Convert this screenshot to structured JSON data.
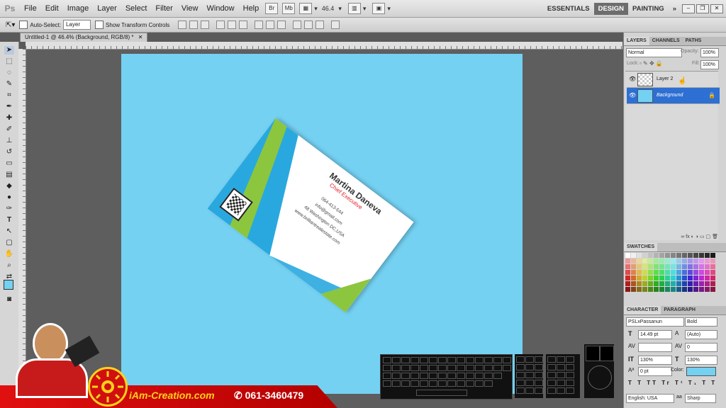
{
  "app": {
    "logo": "Ps"
  },
  "menu": [
    "File",
    "Edit",
    "Image",
    "Layer",
    "Select",
    "Filter",
    "View",
    "Window",
    "Help"
  ],
  "menubar": {
    "zoom": "46.4",
    "workspaces": [
      "ESSENTIALS",
      "DESIGN",
      "PAINTING"
    ],
    "active_workspace": "DESIGN",
    "more": "»"
  },
  "options_bar": {
    "auto_select_label": "Auto-Select:",
    "auto_select_value": "Layer",
    "show_transform_label": "Show Transform Controls"
  },
  "document": {
    "tab_title": "Untitled-1 @ 46.4% (Background, RGB/8) *"
  },
  "card": {
    "name": "Martina Daneva",
    "title": "Chief Executive",
    "phone": "064-413-544",
    "email": "info@gmail.com",
    "address": "48 Washington DC,USA",
    "website": "www.brilliantrealestate.com"
  },
  "layers_panel": {
    "tabs": [
      "LAYERS",
      "CHANNELS",
      "PATHS"
    ],
    "blend_mode": "Normal",
    "opacity_label": "Opacity:",
    "opacity_value": "100%",
    "lock_label": "Lock:",
    "fill_label": "Fill:",
    "fill_value": "100%",
    "layers": [
      {
        "name": "Layer 2",
        "selected": false
      },
      {
        "name": "Background",
        "selected": true
      }
    ]
  },
  "swatches_panel": {
    "title": "SWATCHES"
  },
  "character_panel": {
    "tabs": [
      "CHARACTER",
      "PARAGRAPH"
    ],
    "font_family": "PSLxPassanun",
    "font_style": "Bold",
    "font_size": "14.49 pt",
    "leading": "(Auto)",
    "tracking": "0",
    "vertical_scale": "130%",
    "horizontal_scale": "130%",
    "baseline_shift": "0 pt",
    "color_label": "Color:",
    "language": "English: USA",
    "antialias_icon": "aa",
    "antialias": "Sharp"
  },
  "branding": {
    "site": "iAm-Creation.com",
    "phone": "061-3460479"
  },
  "colors": {
    "canvas": "#74d1f2",
    "layer_selected": "#2d6fd2",
    "card_green": "#8cc63f",
    "card_blue": "#29a8df",
    "name_text": "#333333",
    "title_red": "#e0202a",
    "brand_red": "#d40f0f",
    "brand_yellow": "#ffd21a"
  }
}
